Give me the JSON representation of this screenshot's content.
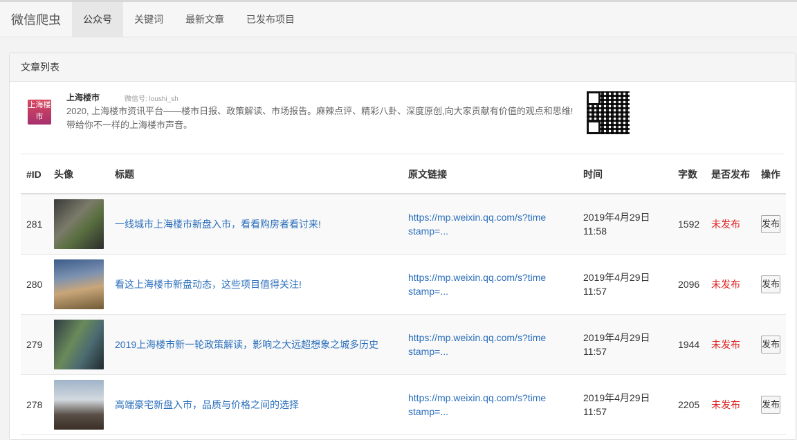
{
  "navbar": {
    "brand": "微信爬虫",
    "items": [
      {
        "label": "公众号",
        "active": true
      },
      {
        "label": "关键词",
        "active": false
      },
      {
        "label": "最新文章",
        "active": false
      },
      {
        "label": "已发布项目",
        "active": false
      }
    ]
  },
  "panel": {
    "heading": "文章列表"
  },
  "account": {
    "logo_text": "上海楼市",
    "name": "上海楼市",
    "id_text": "微信号: loushi_sh",
    "description": "2020, 上海楼市资讯平台——楼市日报、政策解读、市场报告。麻辣点评、精彩八卦、深度原创,向大家贡献有价值的观点和思维!带给你不一样的上海楼市声音。"
  },
  "table": {
    "headers": {
      "id": "#ID",
      "avatar": "头像",
      "title": "标题",
      "link": "原文链接",
      "time": "时间",
      "words": "字数",
      "published": "是否发布",
      "action": "操作"
    },
    "rows": [
      {
        "id": "281",
        "title": "一线城市上海楼市新盘入市，看看购房者看讨来!",
        "url": "https://mp.weixin.qq.com/s?timestamp=...",
        "time": "2019年4月29日 11:58",
        "words": "1592",
        "status": "未发布",
        "action": "发布"
      },
      {
        "id": "280",
        "title": "看这上海楼市新盘动态，这些项目值得关注!",
        "url": "https://mp.weixin.qq.com/s?timestamp=...",
        "time": "2019年4月29日 11:57",
        "words": "2096",
        "status": "未发布",
        "action": "发布"
      },
      {
        "id": "279",
        "title": "2019上海楼市新一轮政策解读，影响之大远超想象之城多历史",
        "url": "https://mp.weixin.qq.com/s?timestamp=...",
        "time": "2019年4月29日 11:57",
        "words": "1944",
        "status": "未发布",
        "action": "发布"
      },
      {
        "id": "278",
        "title": "高端豪宅新盘入市，品质与价格之间的选择",
        "url": "https://mp.weixin.qq.com/s?timestamp=...",
        "time": "2019年4月29日 11:57",
        "words": "2205",
        "status": "未发布",
        "action": "发布"
      }
    ]
  },
  "colors": {
    "link": "#2a6ebb",
    "status_red": "#e02020"
  }
}
